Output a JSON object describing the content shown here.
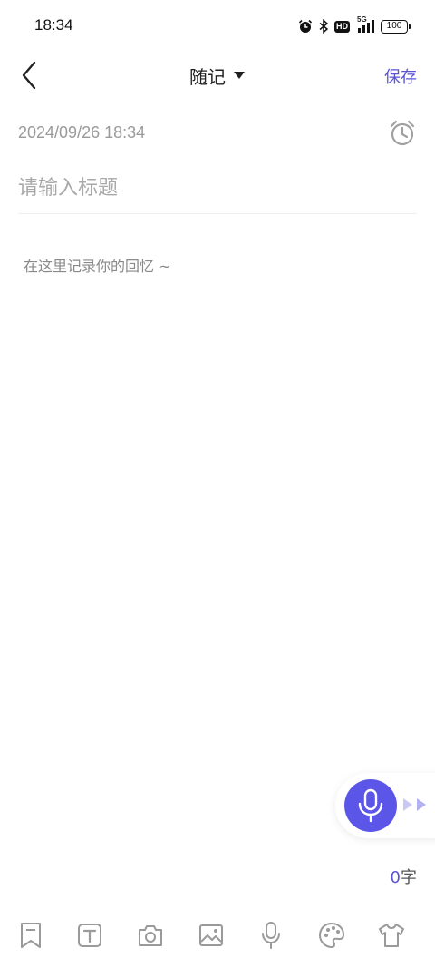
{
  "status_bar": {
    "time": "18:34",
    "network": "5G",
    "hd_label": "HD",
    "battery": "100"
  },
  "header": {
    "title": "随记",
    "save_label": "保存"
  },
  "note": {
    "datetime": "2024/09/26 18:34",
    "title_placeholder": "请输入标题",
    "body_placeholder": "在这里记录你的回忆 ~"
  },
  "word_count": {
    "count": "0",
    "unit": "字"
  },
  "toolbar": {
    "items": [
      "bookmark-icon",
      "text-format-icon",
      "camera-icon",
      "image-icon",
      "microphone-icon",
      "palette-icon",
      "shirt-icon"
    ]
  },
  "colors": {
    "accent": "#5b55e8",
    "save_text": "#5b55d6",
    "placeholder": "#a8a8a8",
    "icon_gray": "#9a9a9a"
  }
}
